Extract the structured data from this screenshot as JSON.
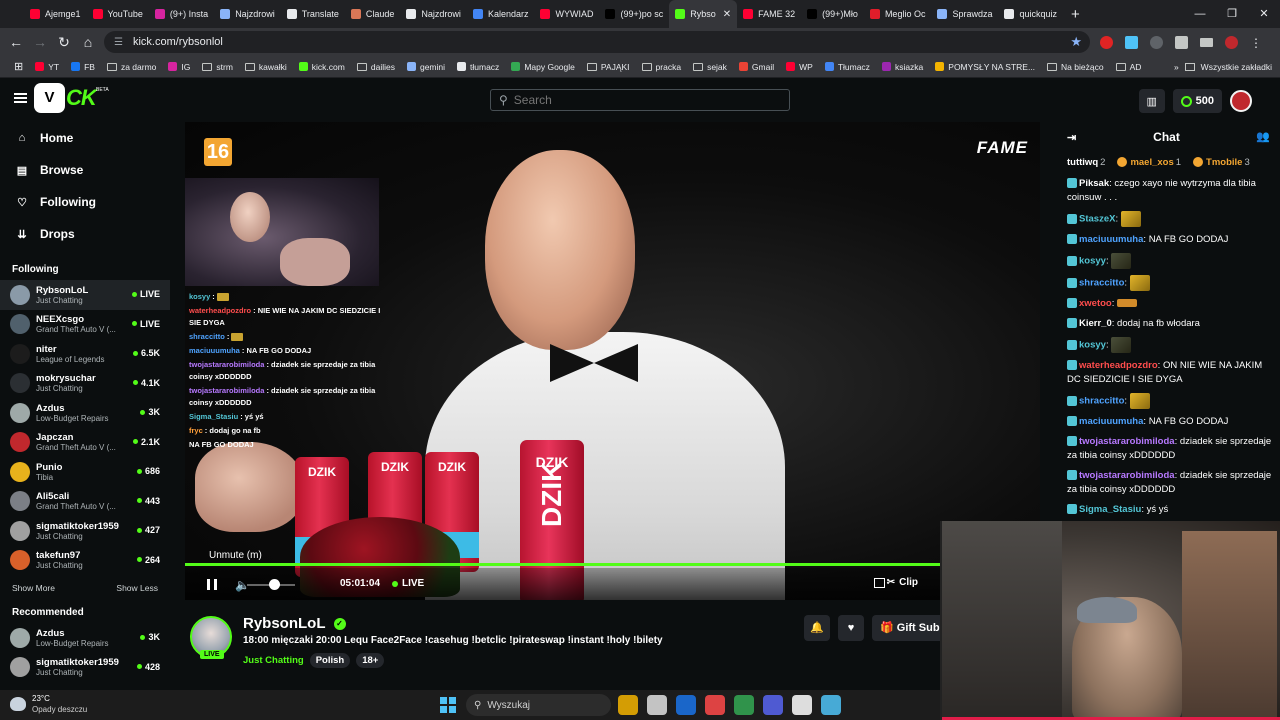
{
  "browser": {
    "tabs": [
      {
        "label": "Ajemge1",
        "color": "#ff0033"
      },
      {
        "label": "YouTube",
        "color": "#ff0033"
      },
      {
        "label": "(9+) Insta",
        "color": "#d6249f"
      },
      {
        "label": "Najzdrowi",
        "color": "#8ab4f8"
      },
      {
        "label": "Translate",
        "color": "#e8eaed"
      },
      {
        "label": "Claude",
        "color": "#d97757"
      },
      {
        "label": "Najzdrowi",
        "color": "#e8eaed"
      },
      {
        "label": "Kalendarz",
        "color": "#4285f4"
      },
      {
        "label": "WYWIAD",
        "color": "#ff0033"
      },
      {
        "label": "(99+)po sc",
        "color": "#000000"
      },
      {
        "label": "Rybso",
        "color": "#53fc18"
      },
      {
        "label": "FAME 32",
        "color": "#ff0033"
      },
      {
        "label": "(99+)Mło",
        "color": "#000000"
      },
      {
        "label": "Meglio Oc",
        "color": "#e11d2a"
      },
      {
        "label": "Sprawdza",
        "color": "#8ab4f8"
      },
      {
        "label": "quickquiz",
        "color": "#e8eaed"
      }
    ],
    "active_tab_index": 10,
    "url": "kick.com/rybsonlol",
    "bookmarks": [
      {
        "label": "YT",
        "color": "#ff0033",
        "folder": false
      },
      {
        "label": "FB",
        "color": "#1877f2",
        "folder": false
      },
      {
        "label": "za darmo",
        "folder": true
      },
      {
        "label": "IG",
        "color": "#d6249f",
        "folder": false
      },
      {
        "label": "strm",
        "folder": true
      },
      {
        "label": "kawałki",
        "folder": true
      },
      {
        "label": "kick.com",
        "color": "#53fc18",
        "folder": false
      },
      {
        "label": "dailies",
        "folder": true
      },
      {
        "label": "gemini",
        "color": "#8ab4f8",
        "folder": false
      },
      {
        "label": "tłumacz",
        "color": "#e8eaed",
        "folder": false
      },
      {
        "label": "Mapy Google",
        "color": "#34a853",
        "folder": false
      },
      {
        "label": "PAJĄKI",
        "folder": true
      },
      {
        "label": "pracka",
        "folder": true
      },
      {
        "label": "sejak",
        "folder": true
      },
      {
        "label": "Gmail",
        "color": "#ea4335",
        "folder": false
      },
      {
        "label": "WP",
        "color": "#ff0033",
        "folder": false
      },
      {
        "label": "Tłumacz",
        "color": "#4285f4",
        "folder": false
      },
      {
        "label": "ksiazka",
        "color": "#9c27b0",
        "folder": false
      },
      {
        "label": "POMYSŁY NA STRE...",
        "color": "#f4b400",
        "folder": false
      },
      {
        "label": "Na bieżąco",
        "folder": true
      },
      {
        "label": "AD",
        "folder": true
      }
    ],
    "all_bookmarks": "Wszystkie zakładki"
  },
  "header": {
    "search_placeholder": "Search",
    "kicks": "500"
  },
  "sidebar": {
    "nav": [
      {
        "label": "Home",
        "icon": "⌂"
      },
      {
        "label": "Browse",
        "icon": "▤"
      },
      {
        "label": "Following",
        "icon": "♡"
      },
      {
        "label": "Drops",
        "icon": "⇊"
      }
    ],
    "following_title": "Following",
    "following": [
      {
        "name": "RybsonLoL",
        "cat": "Just Chatting",
        "viewers": "LIVE",
        "color": "#8a9aa8"
      },
      {
        "name": "NEEXcsgo",
        "cat": "Grand Theft Auto V (...",
        "viewers": "LIVE",
        "color": "#50606c"
      },
      {
        "name": "niter",
        "cat": "League of Legends",
        "viewers": "6.5K",
        "color": "#1c1c1c"
      },
      {
        "name": "mokrysuchar",
        "cat": "Just Chatting",
        "viewers": "4.1K",
        "color": "#2b2f33"
      },
      {
        "name": "Azdus",
        "cat": "Low-Budget Repairs",
        "viewers": "3K",
        "color": "#9ea9a8"
      },
      {
        "name": "Japczan",
        "cat": "Grand Theft Auto V (...",
        "viewers": "2.1K",
        "color": "#c0282d"
      },
      {
        "name": "Punio",
        "cat": "Tibia",
        "viewers": "686",
        "color": "#e8b21c"
      },
      {
        "name": "Ali5cali",
        "cat": "Grand Theft Auto V (...",
        "viewers": "443",
        "color": "#7b7f86"
      },
      {
        "name": "sigmatiktoker1959",
        "cat": "Just Chatting",
        "viewers": "427",
        "color": "#a0a0a0"
      },
      {
        "name": "takefun97",
        "cat": "Just Chatting",
        "viewers": "264",
        "color": "#d8602a"
      }
    ],
    "show_more": "Show More",
    "show_less": "Show Less",
    "recommended_title": "Recommended",
    "recommended": [
      {
        "name": "Azdus",
        "cat": "Low-Budget Repairs",
        "viewers": "3K",
        "color": "#9ea9a8"
      },
      {
        "name": "sigmatiktoker1959",
        "cat": "Just Chatting",
        "viewers": "428",
        "color": "#a0a0a0"
      }
    ]
  },
  "video": {
    "rating": "16",
    "brand": "FAME",
    "can_label": "DZIK",
    "overlay_chat": [
      {
        "user": "kosyy",
        "color": "#53c6d6",
        "text": ""
      },
      {
        "user": "waterheadpozdro",
        "color": "#ff4d4d",
        "text": "NIE WIE NA JAKIM DC SIEDZICIE I SIE DYGA"
      },
      {
        "user": "shraccitto",
        "color": "#4fa3ff",
        "text": ""
      },
      {
        "user": "maciuuumuha",
        "color": "#4fa3ff",
        "text": "NA FB GO DODAJ"
      },
      {
        "user": "twojastararobimiloda",
        "color": "#b779ff",
        "text": "dziadek sie sprzedaje za tibia coinsy xDDDDDD"
      },
      {
        "user": "twojastararobimiloda",
        "color": "#b779ff",
        "text": "dziadek sie sprzedaje za tibia coinsy xDDDDDD"
      },
      {
        "user": "Sigma_Stasiu",
        "color": "#53c6d6",
        "text": "yś yś"
      },
      {
        "user": "fryc",
        "color": "#ff9f3a",
        "text": "dodaj go na fb"
      },
      {
        "user": "",
        "color": "#4fa3ff",
        "text": "NA FB GO DODAJ"
      }
    ],
    "tooltip": "Unmute (m)",
    "time": "05:01:04",
    "live": "LIVE",
    "clip": "Clip",
    "progress": 1.0
  },
  "stream": {
    "name": "RybsonLoL",
    "live_badge": "LIVE",
    "title": "18:00 mięczaki 20:00 Lequ Face2Face !casehug !betclic !pirateswap !instant !holy !bilety",
    "category": "Just Chatting",
    "tags": [
      "Polish",
      "18+"
    ],
    "gift": "Gift Subs"
  },
  "chat": {
    "title": "Chat",
    "leaders": [
      {
        "name": "tuttiwq",
        "count": "2",
        "color": "#ffffff"
      },
      {
        "name": "mael_xos",
        "count": "1",
        "color": "#f3a632"
      },
      {
        "name": "Tmobile",
        "count": "3",
        "color": "#f3a632"
      }
    ],
    "messages": [
      {
        "user": "Piksak",
        "color": "#ffffff",
        "text": "czego xayo nie wytrzyma dla tibia coinsuw . . .",
        "emote": ""
      },
      {
        "user": "StaszeX",
        "color": "#53c6d6",
        "text": "",
        "emote": "gold"
      },
      {
        "user": "maciuuumuha",
        "color": "#4fa3ff",
        "text": "NA FB GO DODAJ",
        "emote": ""
      },
      {
        "user": "kosyy",
        "color": "#53c6d6",
        "text": "",
        "emote": "dark"
      },
      {
        "user": "shraccitto",
        "color": "#4fa3ff",
        "text": "",
        "emote": "gold"
      },
      {
        "user": "xwetoo",
        "color": "#ff4d4d",
        "text": "",
        "emote": "wide"
      },
      {
        "user": "Kierr_0",
        "color": "#ffffff",
        "text": "dodaj na fb włodara",
        "emote": ""
      },
      {
        "user": "kosyy",
        "color": "#53c6d6",
        "text": "",
        "emote": "dark"
      },
      {
        "user": "waterheadpozdro",
        "color": "#ff4d4d",
        "text": "ON NIE WIE NA JAKIM DC SIEDZICIE I SIE DYGA",
        "emote": ""
      },
      {
        "user": "shraccitto",
        "color": "#4fa3ff",
        "text": "",
        "emote": "gold"
      },
      {
        "user": "maciuuumuha",
        "color": "#4fa3ff",
        "text": "NA FB GO DODAJ",
        "emote": ""
      },
      {
        "user": "twojastararobimiloda",
        "color": "#b779ff",
        "text": "dziadek sie sprzedaje za tibia coinsy xDDDDDD",
        "emote": ""
      },
      {
        "user": "twojastararobimiloda",
        "color": "#b779ff",
        "text": "dziadek sie sprzedaje za tibia coinsy xDDDDDD",
        "emote": ""
      },
      {
        "user": "Sigma_Stasiu",
        "color": "#53c6d6",
        "text": "yś yś",
        "emote": ""
      }
    ]
  },
  "taskbar": {
    "temp": "23°C",
    "weather": "Opady deszczu",
    "search": "Wyszukaj",
    "icons": [
      "#f4b400",
      "#e0e0e0",
      "#1a73e8",
      "#ff4a4a",
      "#34a853",
      "#5865f2",
      "#ffffff",
      "#4fc3f7"
    ]
  }
}
